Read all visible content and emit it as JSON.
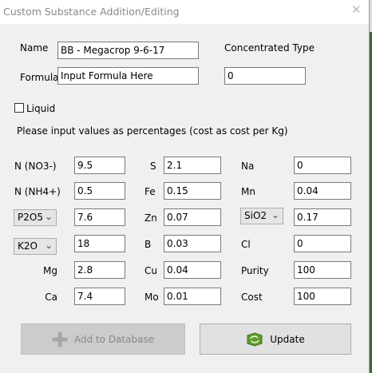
{
  "window": {
    "title": "Custom Substance Addition/Editing",
    "close_glyph": "✕"
  },
  "form": {
    "name_label": "Name",
    "name_value": "BB - Megacrop 9-6-17",
    "formula_label": "Formula",
    "formula_value": "Input Formula Here",
    "concentrated_label": "Concentrated Type",
    "concentrated_value": "0",
    "liquid_label": "Liquid",
    "liquid_checked": false,
    "instructions": "Please input values as percentages (cost as cost per Kg)"
  },
  "nutrients": {
    "n_no3": {
      "label": "N (NO3-)",
      "value": "9.5"
    },
    "n_nh4": {
      "label": "N (NH4+)",
      "value": "0.5"
    },
    "p2o5": {
      "selected": "P2O5",
      "value": "7.6"
    },
    "k2o": {
      "selected": "K2O",
      "value": "18"
    },
    "mg": {
      "label": "Mg",
      "value": "2.8"
    },
    "ca": {
      "label": "Ca",
      "value": "7.4"
    },
    "s": {
      "label": "S",
      "value": "2.1"
    },
    "fe": {
      "label": "Fe",
      "value": "0.15"
    },
    "zn": {
      "label": "Zn",
      "value": "0.07"
    },
    "b": {
      "label": "B",
      "value": "0.03"
    },
    "cu": {
      "label": "Cu",
      "value": "0.04"
    },
    "mo": {
      "label": "Mo",
      "value": "0.01"
    },
    "na": {
      "label": "Na",
      "value": "0"
    },
    "mn": {
      "label": "Mn",
      "value": "0.04"
    },
    "sio2": {
      "selected": "SiO2",
      "value": "0.17"
    },
    "cl": {
      "label": "Cl",
      "value": "0"
    },
    "purity": {
      "label": "Purity",
      "value": "100"
    },
    "cost": {
      "label": "Cost",
      "value": "100"
    }
  },
  "buttons": {
    "add_label": "Add to Database",
    "add_icon": "plus-icon",
    "update_label": "Update",
    "update_icon": "refresh-icon"
  },
  "colors": {
    "accent_green": "#5c9e2e",
    "disabled_text": "#888888"
  }
}
